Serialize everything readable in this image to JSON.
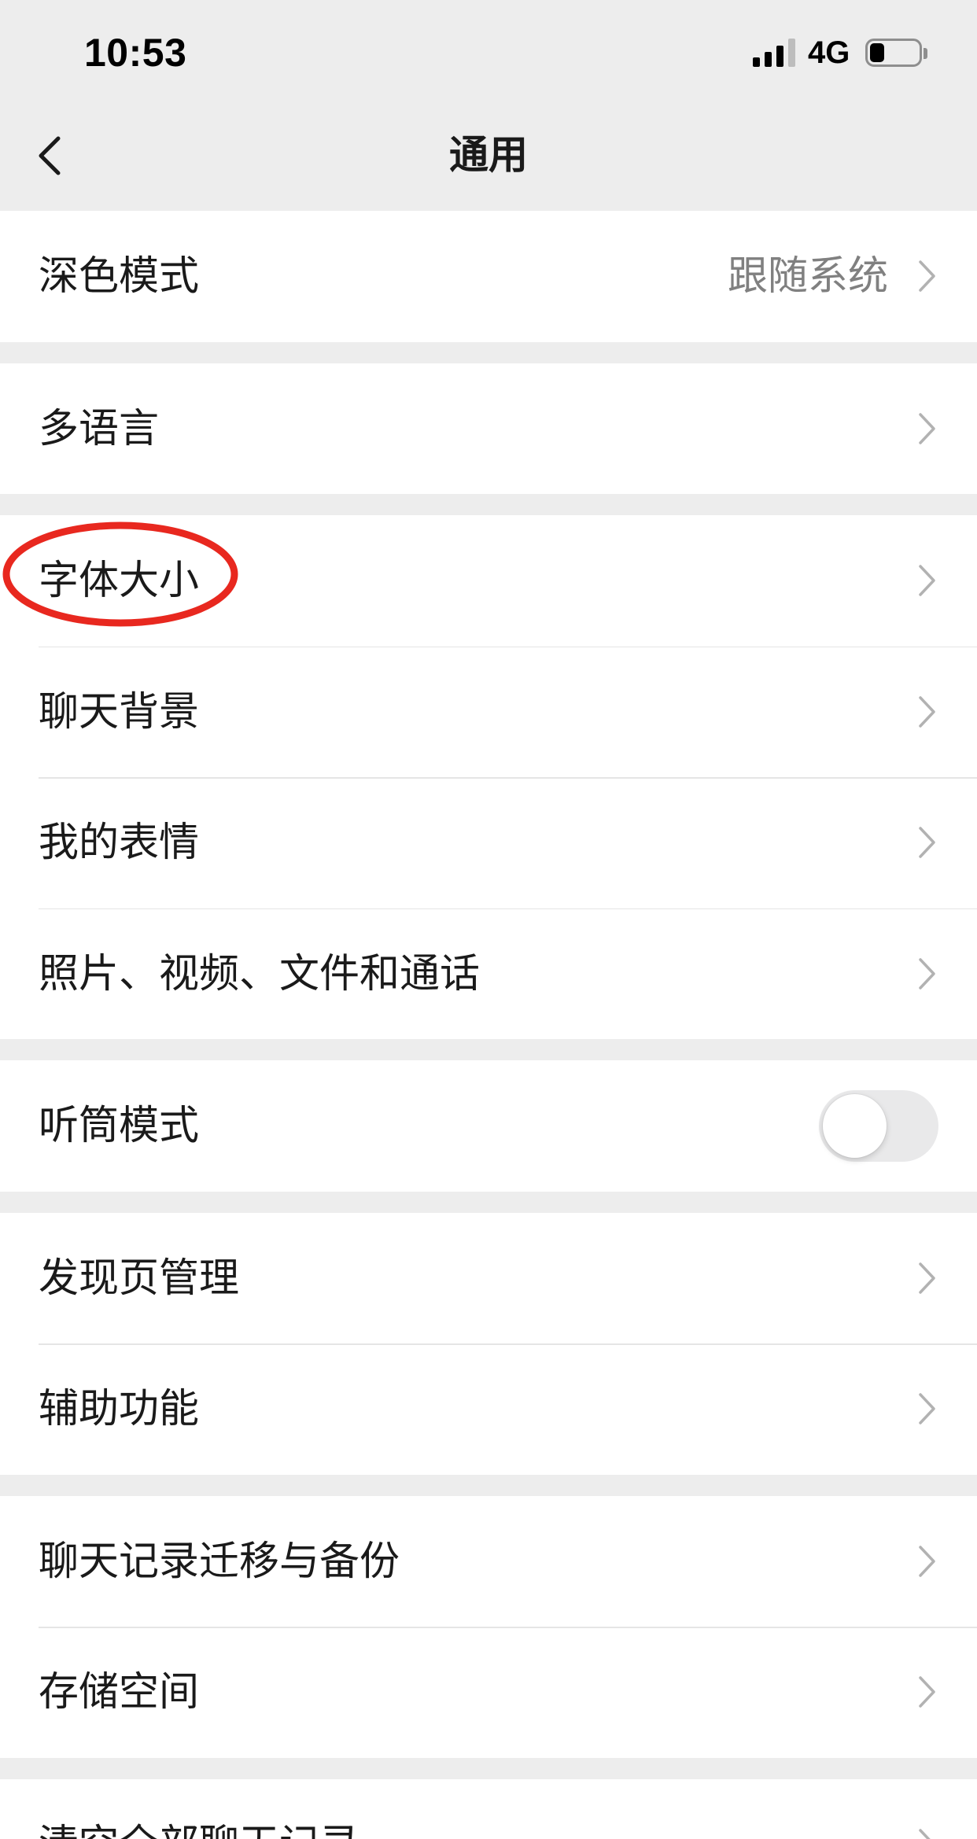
{
  "status_bar": {
    "time": "10:53",
    "network_type": "4G",
    "signal_strength": {
      "filled_bars": 3,
      "total_bars": 4
    },
    "battery_level": 0.3
  },
  "nav_bar": {
    "title": "通用",
    "back_icon": "chevron-left-icon"
  },
  "sections": [
    {
      "rows": [
        {
          "label": "深色模式",
          "value": "跟随系统",
          "icon": "chevron-right-icon"
        }
      ]
    },
    {
      "rows": [
        {
          "label": "多语言",
          "icon": "chevron-right-icon"
        }
      ]
    },
    {
      "rows": [
        {
          "label": "字体大小",
          "icon": "chevron-right-icon",
          "highlighted": true
        },
        {
          "label": "聊天背景",
          "icon": "chevron-right-icon"
        },
        {
          "label": "我的表情",
          "icon": "chevron-right-icon"
        },
        {
          "label": "照片、视频、文件和通话",
          "icon": "chevron-right-icon"
        }
      ]
    },
    {
      "rows": [
        {
          "label": "听筒模式",
          "toggle_on": false
        }
      ]
    },
    {
      "rows": [
        {
          "label": "发现页管理",
          "icon": "chevron-right-icon"
        },
        {
          "label": "辅助功能",
          "icon": "chevron-right-icon"
        }
      ]
    },
    {
      "rows": [
        {
          "label": "聊天记录迁移与备份",
          "icon": "chevron-right-icon"
        },
        {
          "label": "存储空间",
          "icon": "chevron-right-icon"
        }
      ]
    },
    {
      "rows": [
        {
          "label": "清空全部聊天记录",
          "icon": "chevron-right-icon"
        }
      ]
    }
  ],
  "colors": {
    "page_background": "#EDEDED",
    "row_background": "#FFFFFF",
    "text_primary": "#1A1A1A",
    "text_secondary": "#808080",
    "separator": "#E5E5E5",
    "chevron": "#B2B2B2",
    "toggle_off_track": "#E9E9EA",
    "toggle_knob": "#FFFFFF",
    "highlight_ellipse": "#E8281F",
    "status_icon": "#000000",
    "status_icon_dim": "#BDBDBD",
    "battery_outline": "#8E8E8E"
  }
}
